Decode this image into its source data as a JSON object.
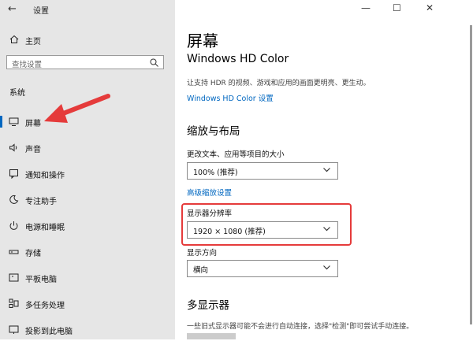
{
  "window": {
    "app_title": "设置"
  },
  "sidebar": {
    "home_label": "主页",
    "search_placeholder": "查找设置",
    "group_label": "系统",
    "items": [
      {
        "label": "屏幕",
        "icon": "monitor-icon",
        "selected": true
      },
      {
        "label": "声音",
        "icon": "speaker-icon"
      },
      {
        "label": "通知和操作",
        "icon": "notification-icon"
      },
      {
        "label": "专注助手",
        "icon": "moon-icon"
      },
      {
        "label": "电源和睡眠",
        "icon": "power-icon"
      },
      {
        "label": "存储",
        "icon": "storage-icon"
      },
      {
        "label": "平板电脑",
        "icon": "tablet-icon"
      },
      {
        "label": "多任务处理",
        "icon": "multitask-icon"
      },
      {
        "label": "投影到此电脑",
        "icon": "project-icon"
      }
    ]
  },
  "main": {
    "title": "屏幕",
    "hd_color": {
      "title": "Windows HD Color",
      "desc": "让支持 HDR 的视频、游戏和应用的画面更明亮、更生动。",
      "link": "Windows HD Color 设置"
    },
    "scale_layout": {
      "title": "缩放与布局",
      "scale_label": "更改文本、应用等项目的大小",
      "scale_value": "100% (推荐)",
      "advanced_link": "高级缩放设置",
      "resolution_label": "显示器分辨率",
      "resolution_value": "1920 × 1080 (推荐)",
      "orientation_label": "显示方向",
      "orientation_value": "横向"
    },
    "multi_display": {
      "title": "多显示器",
      "desc": "一些旧式显示器可能不会进行自动连接，选择\"检测\"即可尝试手动连接。"
    }
  },
  "colors": {
    "accent": "#0067c0",
    "sidebar_bg": "#e6e6e6",
    "annotation_red": "#e53b3b"
  }
}
